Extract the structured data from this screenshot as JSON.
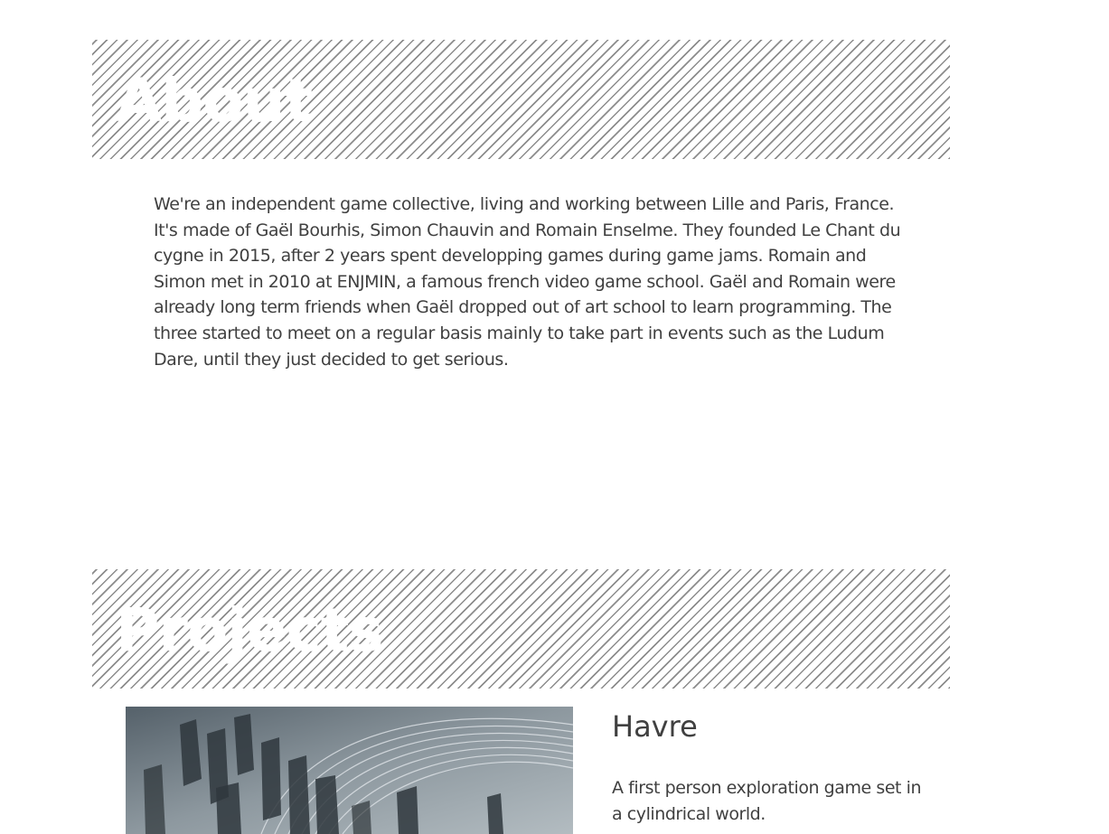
{
  "about": {
    "heading": "About",
    "paragraphs": [
      "We're an independent game collective, living and working between Lille and Paris, France.",
      "It's made of Gaël Bourhis, Simon Chauvin and Romain Enselme. They founded Le Chant du cygne in 2015, after 2 years spent developping games during game jams. Romain and Simon met in 2010 at ENJMIN, a famous french video game school. Gaël and Romain were already long term friends when Gaël dropped out of art school to learn programming. The three started to meet on a regular basis mainly to take part in events such as the Ludum Dare, until they just decided to get serious."
    ]
  },
  "projects": {
    "heading": "Projects",
    "items": [
      {
        "title": "Havre",
        "description": "A first person exploration game set in a cylindrical world."
      }
    ]
  }
}
